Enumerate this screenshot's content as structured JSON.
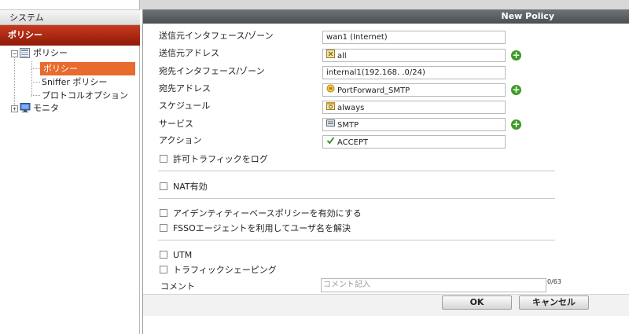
{
  "sidebar": {
    "system_label": "システム",
    "policy_header": "ポリシー",
    "tree": {
      "policy_group": "ポリシー",
      "policy_item": "ポリシー",
      "sniffer_item": "Sniffer ポリシー",
      "protocol_item": "プロトコルオプション",
      "monitor_group": "モニタ"
    }
  },
  "panel": {
    "title": "New Policy"
  },
  "form": {
    "src_interface": {
      "label": "送信元インタフェース/ゾーン",
      "value": "wan1 (Internet)"
    },
    "src_address": {
      "label": "送信元アドレス",
      "value": "all",
      "icon": "address-icon"
    },
    "dst_interface": {
      "label": "宛先インタフェース/ゾーン",
      "value": "internal1(192.168.    .0/24)"
    },
    "dst_address": {
      "label": "宛先アドレス",
      "value": "PortForward_SMTP",
      "icon": "vip-icon"
    },
    "schedule": {
      "label": "スケジュール",
      "value": "always",
      "icon": "schedule-icon"
    },
    "service": {
      "label": "サービス",
      "value": "SMTP",
      "icon": "service-icon"
    },
    "action": {
      "label": "アクション",
      "value": "ACCEPT",
      "icon": "check-icon"
    }
  },
  "options": {
    "log_traffic": "許可トラフィックをログ",
    "nat": "NAT有効",
    "identity": "アイデンティティーベースポリシーを有効にする",
    "fsso": "FSSOエージェントを利用してユーザ名を解決",
    "utm": "UTM",
    "shaping": "トラフィックシェーピング"
  },
  "comment": {
    "label": "コメント",
    "placeholder": "コメント記入",
    "counter": "0/63"
  },
  "buttons": {
    "ok": "OK",
    "cancel": "キャンセル"
  },
  "colors": {
    "policy_header": "#a8260f",
    "selected": "#e86a2c",
    "add": "#3d9a27",
    "title_bar": "#5a5e63"
  }
}
